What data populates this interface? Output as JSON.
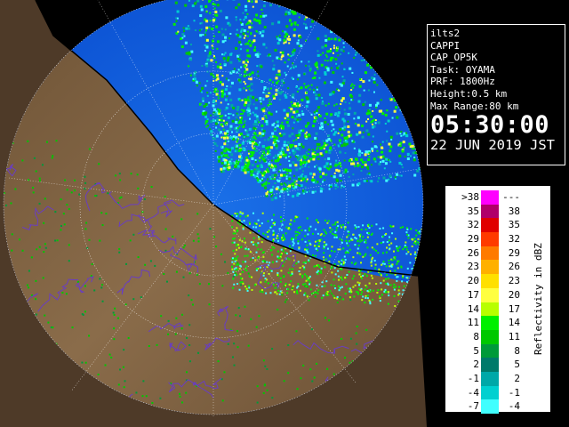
{
  "info": {
    "station": "ilts2",
    "product": "CAPPI",
    "product_code": "CAP_OP5K",
    "task": "Task: OYAMA",
    "prf": "PRF: 1800Hz",
    "height": "Height:0.5 km",
    "max_range": "Max Range:80 km",
    "time": "05:30:00",
    "date": "22 JUN 2019 JST"
  },
  "legend": {
    "title": "Reflectivity in dBZ",
    "rows": [
      {
        "low": ">38",
        "high": "---",
        "color": "#ff00ff"
      },
      {
        "low": "35",
        "high": "38",
        "color": "#b0006a"
      },
      {
        "low": "32",
        "high": "35",
        "color": "#e00000"
      },
      {
        "low": "29",
        "high": "32",
        "color": "#ff3a00"
      },
      {
        "low": "26",
        "high": "29",
        "color": "#ff7a00"
      },
      {
        "low": "23",
        "high": "26",
        "color": "#ffb000"
      },
      {
        "low": "20",
        "high": "23",
        "color": "#ffe000"
      },
      {
        "low": "17",
        "high": "20",
        "color": "#ffff40"
      },
      {
        "low": "14",
        "high": "17",
        "color": "#b8ff00"
      },
      {
        "low": "11",
        "high": "14",
        "color": "#00f000"
      },
      {
        "low": "8",
        "high": "11",
        "color": "#00c800"
      },
      {
        "low": "5",
        "high": "8",
        "color": "#009a3a"
      },
      {
        "low": "2",
        "high": "5",
        "color": "#007a6a"
      },
      {
        "low": "-1",
        "high": "2",
        "color": "#00a8a8"
      },
      {
        "low": "-4",
        "high": "-1",
        "color": "#00d0d0"
      },
      {
        "low": "-7",
        "high": "-4",
        "color": "#40ffff"
      }
    ]
  },
  "colors": {
    "sea": "#1060e0",
    "land": "#7a6042",
    "land_dark": "#4e3a28",
    "rivers": "#6a3ec0",
    "range_ring": "#ffffff",
    "coastline": "#000000"
  }
}
